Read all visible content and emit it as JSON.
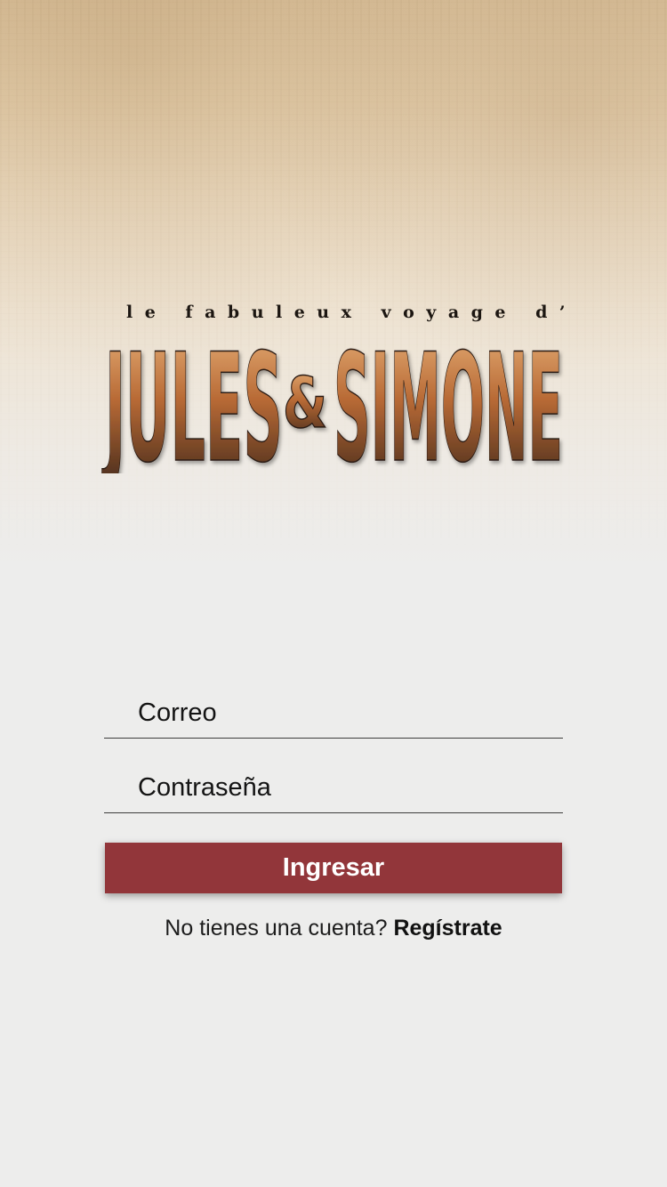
{
  "logo": {
    "tagline": "le fabuleux voyage d’",
    "name_left": "JULES",
    "ampersand": "&",
    "name_right": "SIMONE",
    "colors": {
      "top": "#e8b27a",
      "middle": "#b86a35",
      "bottom": "#3a2419",
      "outline": "#2a1a12"
    }
  },
  "login_form": {
    "email_placeholder": "Correo",
    "password_placeholder": "Contraseña",
    "submit_label": "Ingresar"
  },
  "register": {
    "prompt": "No tienes una cuenta?",
    "link_label": "Regístrate"
  },
  "colors": {
    "accent_button": "#92363a",
    "background": "#ededec"
  }
}
